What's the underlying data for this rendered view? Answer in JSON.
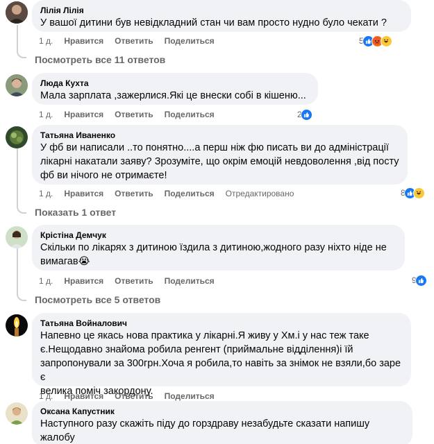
{
  "actions": {
    "like": "Нравится",
    "reply": "Ответить",
    "share": "Поделиться"
  },
  "comments": [
    {
      "author": "Лілія Лілія",
      "text": "У вашої дитини був невідкладний стан чи вам просто нудно було чекати ?",
      "time": "1 д.",
      "reactions_count": "5",
      "reaction_icons": [
        "like-icon",
        "angry-icon",
        "haha-icon"
      ],
      "replies_label": "Посмотреть все 11 ответов"
    },
    {
      "author": "Люда Кухта",
      "text": "Мала зарплата ,зажерлися.Які це внески собі в кішеню...",
      "time": "1 д.",
      "reactions_count": "2",
      "reaction_icons": [
        "like-icon"
      ]
    },
    {
      "author": "Татьяна Иваненко",
      "text": "У фб ви написали ..то понятно....а перш ніж фю писать ви до адміністрації\nлікарні накатали заяву? Зрозуміте, що окрім емоцій невдоволення ,від посту\nфб ви нічого не отримаєте!",
      "time": "1 д.",
      "edited": "Отредактировано",
      "reactions_count": "8",
      "reaction_icons": [
        "like-icon",
        "haha-icon"
      ],
      "replies_label": "Показать 1 ответ"
    },
    {
      "author": "Крістіна Демчук",
      "text": "Скільки по лікарях з дитиною їздила з дитиною,жодного разу ніхто ніде не\nвимагав😭",
      "time": "1 д.",
      "reactions_count": "9",
      "reaction_icons": [
        "like-icon"
      ],
      "replies_label": "Посмотреть все 5 ответов"
    },
    {
      "author": "Татьяна Войналович",
      "text": "Напевно це якась нова практика у лікарні.Я живу у Хм.і у нас теж таке\nє.Нещодавно знайома робила ренгент (приймальне відділення)і їй\nзапропонували за 300грн.Хоча я робила,то навіть за знімок не взяли,бо заре є\nвелика поміч закордону.",
      "time": "1 д."
    },
    {
      "author": "Оксана Капустник",
      "text": "Наступного разу скажіть піду до горздраву незабудьте сказати напишу жалобу\nще і у департамент до омбуцмена"
    }
  ],
  "colors": {
    "bubble": "#f0f2f5",
    "meta": "#65676b",
    "like": "#1877f2"
  }
}
